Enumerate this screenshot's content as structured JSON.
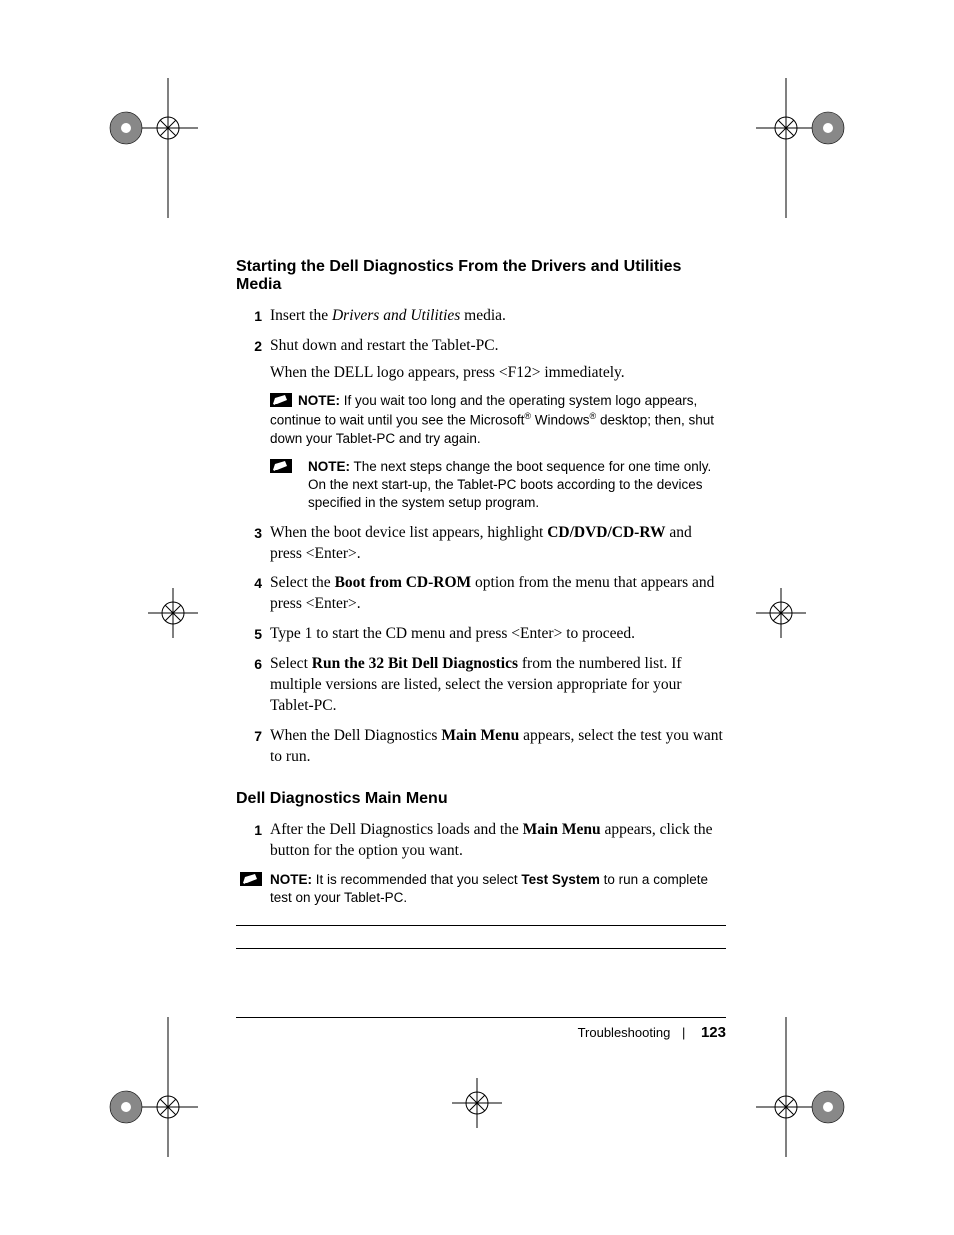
{
  "heading1": "Starting the Dell Diagnostics From the Drivers and Utilities Media",
  "steps1": {
    "s1": {
      "num": "1",
      "pre": "Insert the ",
      "italic": "Drivers and Utilities",
      "post": " media."
    },
    "s2": {
      "num": "2",
      "text": "Shut down and restart the Tablet-PC.",
      "sub": "When the DELL logo appears, press <F12> immediately.",
      "note1": {
        "label": "NOTE:",
        "pre": " If you wait too long and the operating system logo appears, continue to wait until you see the Microsoft",
        "reg1": "®",
        "mid": " Windows",
        "reg2": "®",
        "post": " desktop; then, shut down your Tablet-PC and try again."
      },
      "note2": {
        "label": "NOTE:",
        "text": " The next steps change the boot sequence for one time only. On the next start-up, the Tablet-PC boots according to the devices specified in the system setup program."
      }
    },
    "s3": {
      "num": "3",
      "pre": "When the boot device list appears, highlight ",
      "bold": "CD/DVD/CD-RW",
      "post": " and press <Enter>."
    },
    "s4": {
      "num": "4",
      "pre": "Select the ",
      "bold": "Boot from CD-ROM",
      "post": " option from the menu that appears and press <Enter>."
    },
    "s5": {
      "num": "5",
      "text": "Type 1 to start the CD menu and press <Enter> to proceed."
    },
    "s6": {
      "num": "6",
      "pre": "Select ",
      "bold": "Run the 32 Bit Dell Diagnostics",
      "post": " from the numbered list. If multiple versions are listed, select the version appropriate for your Tablet-PC."
    },
    "s7": {
      "num": "7",
      "pre": "When the Dell Diagnostics ",
      "bold": "Main Menu",
      "post": " appears, select the test you want to run."
    }
  },
  "heading2": "Dell Diagnostics Main Menu",
  "steps2": {
    "s1": {
      "num": "1",
      "pre": "After the Dell Diagnostics loads and the ",
      "bold": "Main Menu",
      "post": " appears, click the button for the option you want."
    }
  },
  "note3": {
    "label": "NOTE:",
    "pre": " It is recommended that you select ",
    "bold": "Test System",
    "post": " to run a complete test on your Tablet-PC."
  },
  "footer": {
    "section": "Troubleshooting",
    "sep": "|",
    "page": "123"
  }
}
